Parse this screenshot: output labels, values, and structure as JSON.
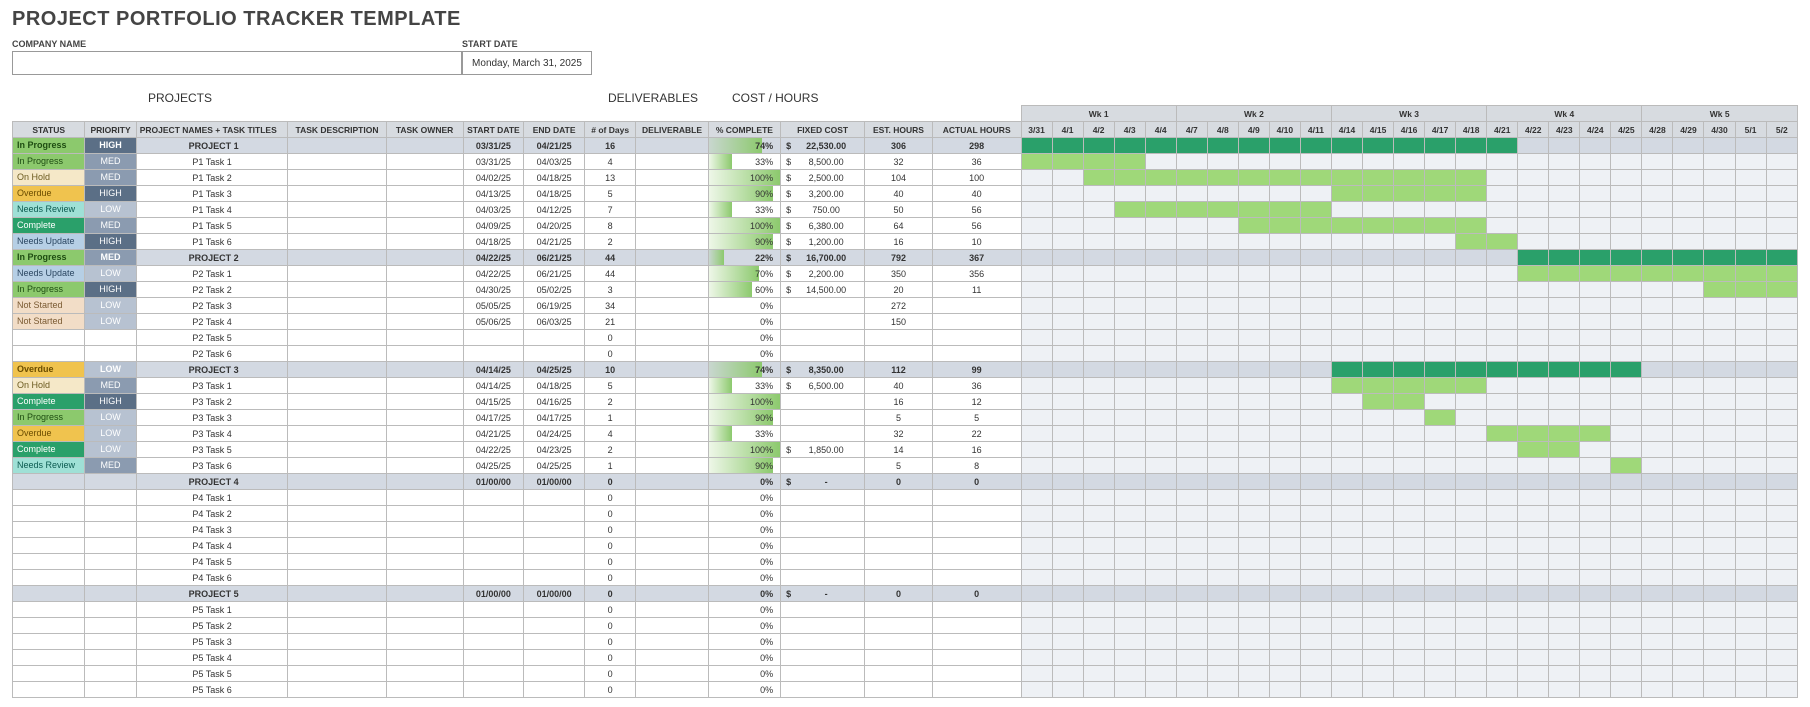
{
  "title": "PROJECT PORTFOLIO TRACKER TEMPLATE",
  "company_label": "COMPANY NAME",
  "company_value": "",
  "start_date_label": "START DATE",
  "start_date_value": "Monday, March 31, 2025",
  "sections": {
    "projects": "PROJECTS",
    "deliverables": "DELIVERABLES",
    "cost": "COST / HOURS"
  },
  "columns": {
    "status": "STATUS",
    "priority": "PRIORITY",
    "name": "PROJECT NAMES + TASK TITLES",
    "desc": "TASK DESCRIPTION",
    "owner": "TASK OWNER",
    "sdate": "START DATE",
    "edate": "END DATE",
    "days": "# of Days",
    "deliverable": "DELIVERABLE",
    "pct": "% COMPLETE",
    "cost": "FIXED COST",
    "est": "EST. HOURS",
    "act": "ACTUAL HOURS"
  },
  "weeks": [
    {
      "label": "Wk 1",
      "days": [
        "3/31",
        "4/1",
        "4/2",
        "4/3",
        "4/4"
      ]
    },
    {
      "label": "Wk 2",
      "days": [
        "4/7",
        "4/8",
        "4/9",
        "4/10",
        "4/11"
      ]
    },
    {
      "label": "Wk 3",
      "days": [
        "4/14",
        "4/15",
        "4/16",
        "4/17",
        "4/18"
      ]
    },
    {
      "label": "Wk 4",
      "days": [
        "4/21",
        "4/22",
        "4/23",
        "4/24",
        "4/25"
      ]
    },
    {
      "label": "Wk 5",
      "days": [
        "4/28",
        "4/29",
        "4/30",
        "5/1",
        "5/2"
      ]
    }
  ],
  "rows": [
    {
      "type": "project",
      "status": "In Progress",
      "priority": "HIGH",
      "name": "PROJECT 1",
      "sdate": "03/31/25",
      "edate": "04/21/25",
      "days": "16",
      "pct": "74%",
      "cost": "22,530.00",
      "est": "306",
      "act": "298",
      "bar": [
        0,
        15
      ]
    },
    {
      "type": "task",
      "status": "In Progress",
      "priority": "MED",
      "name": "P1 Task 1",
      "sdate": "03/31/25",
      "edate": "04/03/25",
      "days": "4",
      "pct": "33%",
      "cost": "8,500.00",
      "est": "32",
      "act": "36",
      "bar": [
        0,
        3
      ]
    },
    {
      "type": "task",
      "status": "On Hold",
      "priority": "MED",
      "name": "P1 Task 2",
      "sdate": "04/02/25",
      "edate": "04/18/25",
      "days": "13",
      "pct": "100%",
      "cost": "2,500.00",
      "est": "104",
      "act": "100",
      "bar": [
        2,
        14
      ]
    },
    {
      "type": "task",
      "status": "Overdue",
      "priority": "HIGH",
      "name": "P1 Task 3",
      "sdate": "04/13/25",
      "edate": "04/18/25",
      "days": "5",
      "pct": "90%",
      "cost": "3,200.00",
      "est": "40",
      "act": "40",
      "bar": [
        10,
        14
      ]
    },
    {
      "type": "task",
      "status": "Needs Review",
      "priority": "LOW",
      "name": "P1 Task 4",
      "sdate": "04/03/25",
      "edate": "04/12/25",
      "days": "7",
      "pct": "33%",
      "cost": "750.00",
      "est": "50",
      "act": "56",
      "bar": [
        3,
        9
      ]
    },
    {
      "type": "task",
      "status": "Complete",
      "priority": "MED",
      "name": "P1 Task 5",
      "sdate": "04/09/25",
      "edate": "04/20/25",
      "days": "8",
      "pct": "100%",
      "cost": "6,380.00",
      "est": "64",
      "act": "56",
      "bar": [
        7,
        14
      ]
    },
    {
      "type": "task",
      "status": "Needs Update",
      "priority": "HIGH",
      "name": "P1 Task 6",
      "sdate": "04/18/25",
      "edate": "04/21/25",
      "days": "2",
      "pct": "90%",
      "cost": "1,200.00",
      "est": "16",
      "act": "10",
      "bar": [
        14,
        15
      ]
    },
    {
      "type": "project",
      "status": "In Progress",
      "priority": "MED",
      "name": "PROJECT 2",
      "sdate": "04/22/25",
      "edate": "06/21/25",
      "days": "44",
      "pct": "22%",
      "cost": "16,700.00",
      "est": "792",
      "act": "367",
      "bar": [
        16,
        24
      ]
    },
    {
      "type": "task",
      "status": "Needs Update",
      "priority": "LOW",
      "name": "P2 Task 1",
      "sdate": "04/22/25",
      "edate": "06/21/25",
      "days": "44",
      "pct": "70%",
      "cost": "2,200.00",
      "est": "350",
      "act": "356",
      "bar": [
        16,
        24
      ]
    },
    {
      "type": "task",
      "status": "In Progress",
      "priority": "HIGH",
      "name": "P2 Task 2",
      "sdate": "04/30/25",
      "edate": "05/02/25",
      "days": "3",
      "pct": "60%",
      "cost": "14,500.00",
      "est": "20",
      "act": "11",
      "bar": [
        22,
        24
      ]
    },
    {
      "type": "task",
      "status": "Not Started",
      "priority": "LOW",
      "name": "P2 Task 3",
      "sdate": "05/05/25",
      "edate": "06/19/25",
      "days": "34",
      "pct": "0%",
      "cost": "",
      "est": "272",
      "act": "",
      "bar": null
    },
    {
      "type": "task",
      "status": "Not Started",
      "priority": "LOW",
      "name": "P2 Task 4",
      "sdate": "05/06/25",
      "edate": "06/03/25",
      "days": "21",
      "pct": "0%",
      "cost": "",
      "est": "150",
      "act": "",
      "bar": null
    },
    {
      "type": "task",
      "status": "",
      "priority": "",
      "name": "P2 Task 5",
      "sdate": "",
      "edate": "",
      "days": "0",
      "pct": "0%",
      "cost": "",
      "est": "",
      "act": "",
      "bar": null
    },
    {
      "type": "task",
      "status": "",
      "priority": "",
      "name": "P2 Task 6",
      "sdate": "",
      "edate": "",
      "days": "0",
      "pct": "0%",
      "cost": "",
      "est": "",
      "act": "",
      "bar": null
    },
    {
      "type": "project",
      "status": "Overdue",
      "priority": "LOW",
      "name": "PROJECT 3",
      "sdate": "04/14/25",
      "edate": "04/25/25",
      "days": "10",
      "pct": "74%",
      "cost": "8,350.00",
      "est": "112",
      "act": "99",
      "bar": [
        10,
        19
      ]
    },
    {
      "type": "task",
      "status": "On Hold",
      "priority": "MED",
      "name": "P3 Task 1",
      "sdate": "04/14/25",
      "edate": "04/18/25",
      "days": "5",
      "pct": "33%",
      "cost": "6,500.00",
      "est": "40",
      "act": "36",
      "bar": [
        10,
        14
      ]
    },
    {
      "type": "task",
      "status": "Complete",
      "priority": "HIGH",
      "name": "P3 Task 2",
      "sdate": "04/15/25",
      "edate": "04/16/25",
      "days": "2",
      "pct": "100%",
      "cost": "",
      "est": "16",
      "act": "12",
      "bar": [
        11,
        12
      ]
    },
    {
      "type": "task",
      "status": "In Progress",
      "priority": "LOW",
      "name": "P3 Task 3",
      "sdate": "04/17/25",
      "edate": "04/17/25",
      "days": "1",
      "pct": "90%",
      "cost": "",
      "est": "5",
      "act": "5",
      "bar": [
        13,
        13
      ]
    },
    {
      "type": "task",
      "status": "Overdue",
      "priority": "LOW",
      "name": "P3 Task 4",
      "sdate": "04/21/25",
      "edate": "04/24/25",
      "days": "4",
      "pct": "33%",
      "cost": "",
      "est": "32",
      "act": "22",
      "bar": [
        15,
        18
      ]
    },
    {
      "type": "task",
      "status": "Complete",
      "priority": "LOW",
      "name": "P3 Task 5",
      "sdate": "04/22/25",
      "edate": "04/23/25",
      "days": "2",
      "pct": "100%",
      "cost": "1,850.00",
      "est": "14",
      "act": "16",
      "bar": [
        16,
        17
      ]
    },
    {
      "type": "task",
      "status": "Needs Review",
      "priority": "MED",
      "name": "P3 Task 6",
      "sdate": "04/25/25",
      "edate": "04/25/25",
      "days": "1",
      "pct": "90%",
      "cost": "",
      "est": "5",
      "act": "8",
      "bar": [
        19,
        19
      ]
    },
    {
      "type": "project",
      "status": "",
      "priority": "",
      "name": "PROJECT 4",
      "sdate": "01/00/00",
      "edate": "01/00/00",
      "days": "0",
      "pct": "0%",
      "cost": "-",
      "est": "0",
      "act": "0",
      "bar": null
    },
    {
      "type": "task",
      "status": "",
      "priority": "",
      "name": "P4 Task 1",
      "sdate": "",
      "edate": "",
      "days": "0",
      "pct": "0%",
      "cost": "",
      "est": "",
      "act": "",
      "bar": null
    },
    {
      "type": "task",
      "status": "",
      "priority": "",
      "name": "P4 Task 2",
      "sdate": "",
      "edate": "",
      "days": "0",
      "pct": "0%",
      "cost": "",
      "est": "",
      "act": "",
      "bar": null
    },
    {
      "type": "task",
      "status": "",
      "priority": "",
      "name": "P4 Task 3",
      "sdate": "",
      "edate": "",
      "days": "0",
      "pct": "0%",
      "cost": "",
      "est": "",
      "act": "",
      "bar": null
    },
    {
      "type": "task",
      "status": "",
      "priority": "",
      "name": "P4 Task 4",
      "sdate": "",
      "edate": "",
      "days": "0",
      "pct": "0%",
      "cost": "",
      "est": "",
      "act": "",
      "bar": null
    },
    {
      "type": "task",
      "status": "",
      "priority": "",
      "name": "P4 Task 5",
      "sdate": "",
      "edate": "",
      "days": "0",
      "pct": "0%",
      "cost": "",
      "est": "",
      "act": "",
      "bar": null
    },
    {
      "type": "task",
      "status": "",
      "priority": "",
      "name": "P4 Task 6",
      "sdate": "",
      "edate": "",
      "days": "0",
      "pct": "0%",
      "cost": "",
      "est": "",
      "act": "",
      "bar": null
    },
    {
      "type": "project",
      "status": "",
      "priority": "",
      "name": "PROJECT 5",
      "sdate": "01/00/00",
      "edate": "01/00/00",
      "days": "0",
      "pct": "0%",
      "cost": "-",
      "est": "0",
      "act": "0",
      "bar": null
    },
    {
      "type": "task",
      "status": "",
      "priority": "",
      "name": "P5 Task 1",
      "sdate": "",
      "edate": "",
      "days": "0",
      "pct": "0%",
      "cost": "",
      "est": "",
      "act": "",
      "bar": null
    },
    {
      "type": "task",
      "status": "",
      "priority": "",
      "name": "P5 Task 2",
      "sdate": "",
      "edate": "",
      "days": "0",
      "pct": "0%",
      "cost": "",
      "est": "",
      "act": "",
      "bar": null
    },
    {
      "type": "task",
      "status": "",
      "priority": "",
      "name": "P5 Task 3",
      "sdate": "",
      "edate": "",
      "days": "0",
      "pct": "0%",
      "cost": "",
      "est": "",
      "act": "",
      "bar": null
    },
    {
      "type": "task",
      "status": "",
      "priority": "",
      "name": "P5 Task 4",
      "sdate": "",
      "edate": "",
      "days": "0",
      "pct": "0%",
      "cost": "",
      "est": "",
      "act": "",
      "bar": null
    },
    {
      "type": "task",
      "status": "",
      "priority": "",
      "name": "P5 Task 5",
      "sdate": "",
      "edate": "",
      "days": "0",
      "pct": "0%",
      "cost": "",
      "est": "",
      "act": "",
      "bar": null
    },
    {
      "type": "task",
      "status": "",
      "priority": "",
      "name": "P5 Task 6",
      "sdate": "",
      "edate": "",
      "days": "0",
      "pct": "0%",
      "cost": "",
      "est": "",
      "act": "",
      "bar": null
    }
  ],
  "status_classes": {
    "In Progress": "InProgress",
    "On Hold": "OnHold",
    "Overdue": "Overdue",
    "Needs Review": "NeedsReview",
    "Complete": "Complete",
    "Needs Update": "NeedsUpdate",
    "Not Started": "NotStarted"
  }
}
